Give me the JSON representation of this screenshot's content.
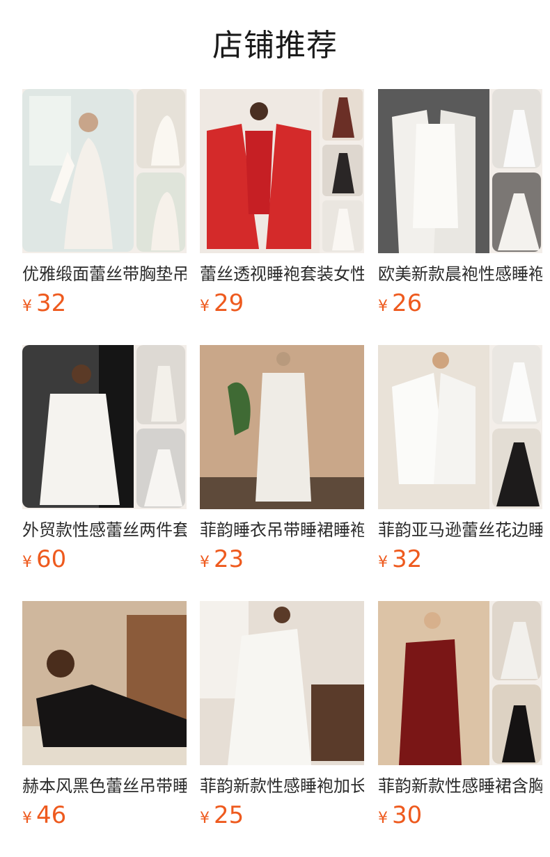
{
  "header": {
    "title": "店铺推荐"
  },
  "products": [
    {
      "name": "优雅缎面蕾丝带胸垫吊带睡裙",
      "currency": "¥",
      "price": "32"
    },
    {
      "name": "蕾丝透视睡袍套装女性感",
      "currency": "¥",
      "price": "29"
    },
    {
      "name": "欧美新款晨袍性感睡袍",
      "currency": "¥",
      "price": "26"
    },
    {
      "name": "外贸款性感蕾丝两件套",
      "currency": "¥",
      "price": "60"
    },
    {
      "name": "菲韵睡衣吊带睡裙睡袍",
      "currency": "¥",
      "price": "23"
    },
    {
      "name": "菲韵亚马逊蕾丝花边睡袍",
      "currency": "¥",
      "price": "32"
    },
    {
      "name": "赫本风黑色蕾丝吊带睡裙",
      "currency": "¥",
      "price": "46"
    },
    {
      "name": "菲韵新款性感睡袍加长",
      "currency": "¥",
      "price": "25"
    },
    {
      "name": "菲韵新款性感睡裙含胸垫",
      "currency": "¥",
      "price": "30"
    }
  ],
  "colors": {
    "price": "#ee5a1e",
    "title": "#1a1a1a"
  }
}
